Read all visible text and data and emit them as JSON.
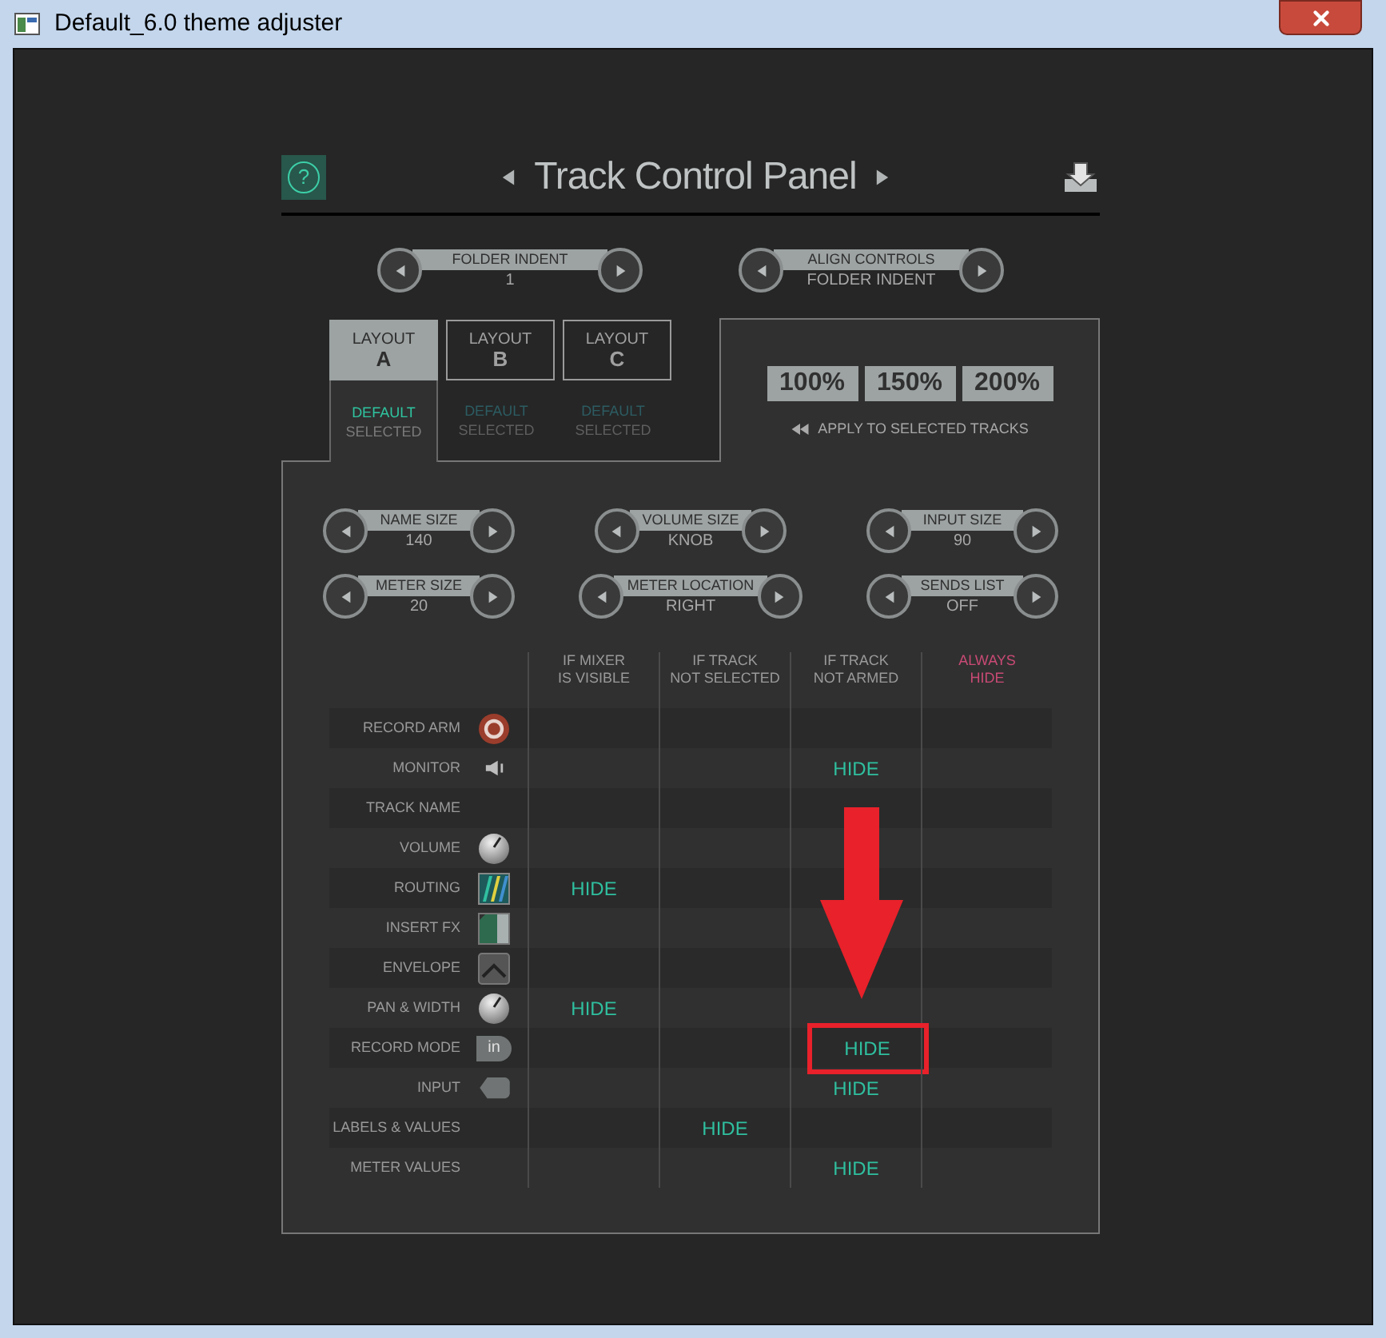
{
  "window": {
    "title": "Default_6.0 theme adjuster"
  },
  "panel": {
    "title": "Track Control Panel",
    "help_label": "?"
  },
  "top_controls": [
    {
      "label": "FOLDER INDENT",
      "value": "1"
    },
    {
      "label": "ALIGN CONTROLS",
      "value": "FOLDER INDENT"
    }
  ],
  "layouts": [
    {
      "label": "LAYOUT",
      "letter": "A",
      "selected": true,
      "status": "DEFAULT",
      "status_sub": "SELECTED"
    },
    {
      "label": "LAYOUT",
      "letter": "B",
      "selected": false,
      "status": "DEFAULT",
      "status_sub": "SELECTED"
    },
    {
      "label": "LAYOUT",
      "letter": "C",
      "selected": false,
      "status": "DEFAULT",
      "status_sub": "SELECTED"
    }
  ],
  "scale_buttons": [
    "100%",
    "150%",
    "200%"
  ],
  "apply_label": "APPLY TO SELECTED TRACKS",
  "size_controls": [
    {
      "label": "NAME SIZE",
      "value": "140"
    },
    {
      "label": "VOLUME SIZE",
      "value": "KNOB"
    },
    {
      "label": "INPUT SIZE",
      "value": "90"
    },
    {
      "label": "METER SIZE",
      "value": "20"
    },
    {
      "label": "METER LOCATION",
      "value": "RIGHT"
    },
    {
      "label": "SENDS LIST",
      "value": "OFF"
    }
  ],
  "table": {
    "columns": [
      {
        "label": "IF MIXER\nIS VISIBLE",
        "kind": "condition"
      },
      {
        "label": "IF TRACK\nNOT SELECTED",
        "kind": "condition"
      },
      {
        "label": "IF TRACK\nNOT ARMED",
        "kind": "condition"
      },
      {
        "label": "ALWAYS\nHIDE",
        "kind": "always"
      }
    ],
    "rows": [
      {
        "label": "RECORD ARM",
        "kind": "record",
        "cells": [
          null,
          null,
          null,
          null
        ]
      },
      {
        "label": "MONITOR",
        "kind": "speaker",
        "cells": [
          null,
          null,
          {
            "text": "HIDE",
            "highlighted": false
          },
          null
        ]
      },
      {
        "label": "TRACK NAME",
        "kind": "plain",
        "cells": [
          null,
          null,
          null,
          null
        ]
      },
      {
        "label": "VOLUME",
        "kind": "knob",
        "cells": [
          null,
          null,
          null,
          null
        ]
      },
      {
        "label": "ROUTING",
        "kind": "routing",
        "cells": [
          {
            "text": "HIDE",
            "highlighted": false
          },
          null,
          null,
          null
        ]
      },
      {
        "label": "INSERT FX",
        "kind": "fx",
        "cells": [
          null,
          null,
          null,
          null
        ]
      },
      {
        "label": "ENVELOPE",
        "kind": "envelope",
        "cells": [
          null,
          null,
          null,
          null
        ]
      },
      {
        "label": "PAN & WIDTH",
        "kind": "knob",
        "cells": [
          {
            "text": "HIDE",
            "highlighted": false
          },
          null,
          null,
          null
        ]
      },
      {
        "label": "RECORD MODE",
        "kind": "recmode",
        "icon_text": "in",
        "cells": [
          null,
          null,
          {
            "text": "HIDE",
            "highlighted": true
          },
          null
        ]
      },
      {
        "label": "INPUT",
        "kind": "input",
        "cells": [
          null,
          null,
          {
            "text": "HIDE",
            "highlighted": false
          },
          null
        ]
      },
      {
        "label": "LABELS & VALUES",
        "kind": "plain",
        "cells": [
          null,
          {
            "text": "HIDE",
            "highlighted": false
          },
          null,
          null
        ]
      },
      {
        "label": "METER VALUES",
        "kind": "plain",
        "cells": [
          null,
          null,
          {
            "text": "HIDE",
            "highlighted": false
          },
          null
        ]
      }
    ]
  }
}
